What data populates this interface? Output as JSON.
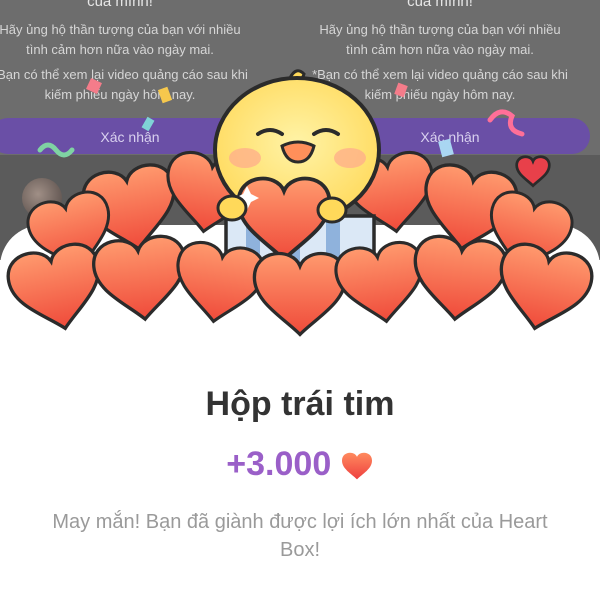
{
  "background_dialog": {
    "title": "của mình!",
    "description": "Hãy ủng hộ thần tượng của bạn với nhiều tình cảm hơn nữa vào ngày mai.",
    "note": "*Bạn có thể xem lại video quảng cáo sau khi kiếm phiếu ngày hôm nay.",
    "confirm_label": "Xác nhận"
  },
  "reward": {
    "title": "Hộp trái tim",
    "amount": "+3.000",
    "icon": "heart-icon",
    "description": "May mắn! Bạn đã giành được lợi ích lớn nhất của Heart Box!"
  },
  "colors": {
    "accent_purple": "#9a5fc8",
    "heart_red": "#f0563f",
    "chick_yellow": "#ffe57a"
  }
}
